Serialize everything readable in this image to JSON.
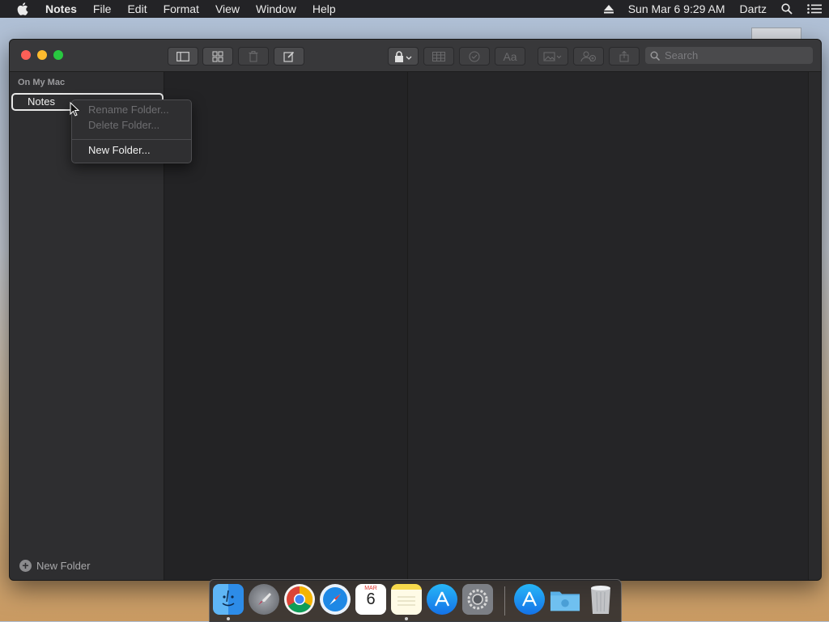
{
  "menubar": {
    "app_name": "Notes",
    "items": [
      "File",
      "Edit",
      "Format",
      "View",
      "Window",
      "Help"
    ],
    "datetime": "Sun Mar 6  9:29 AM",
    "user": "Dartz"
  },
  "window": {
    "search_placeholder": "Search"
  },
  "sidebar": {
    "heading": "On My Mac",
    "folder": "Notes",
    "new_folder_label": "New Folder"
  },
  "context_menu": {
    "rename": "Rename Folder...",
    "delete": "Delete Folder...",
    "new": "New Folder..."
  },
  "dock": {
    "apps": [
      "finder-icon",
      "launchpad-icon",
      "chrome-icon",
      "safari-icon",
      "calendar-icon",
      "notes-icon",
      "app-store-icon",
      "system-preferences-icon",
      "downloads-icon",
      "folder-icon",
      "trash-icon"
    ],
    "calendar_month": "MAR",
    "calendar_day": "6"
  },
  "colors": {
    "close": "#fe5f57",
    "minimize": "#febb2e",
    "zoom": "#28c840"
  }
}
